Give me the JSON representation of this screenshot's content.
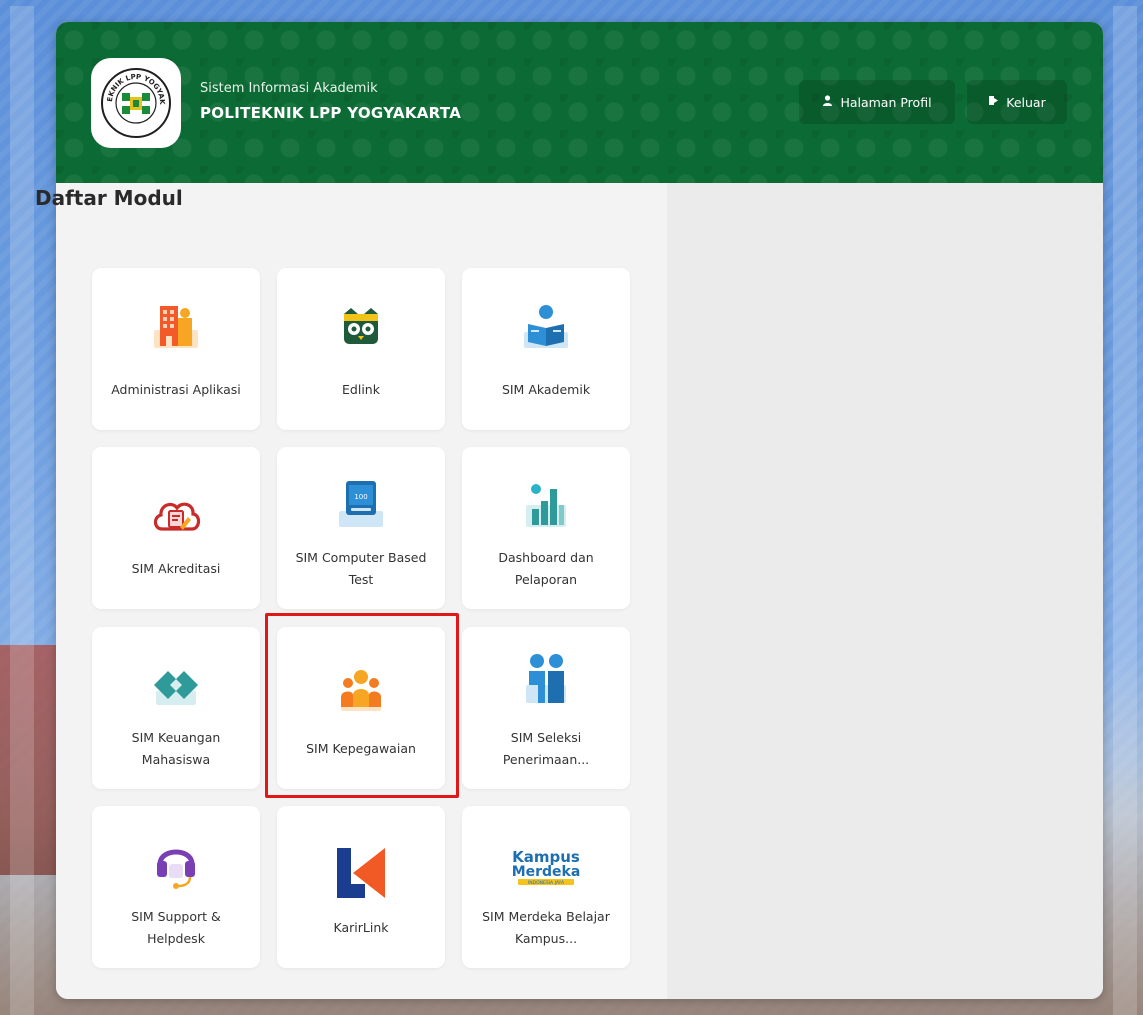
{
  "header": {
    "subtitle": "Sistem Informasi Akademik",
    "title": "POLITEKNIK LPP YOGYAKARTA",
    "logo_ring_text": "POLITEKNIK LPP YOGYAKARTA",
    "buttons": {
      "profile_label": "Halaman Profil",
      "profile_icon": "user-icon",
      "logout_label": "Keluar",
      "logout_icon": "logout-icon"
    }
  },
  "section": {
    "title": "Daftar Modul"
  },
  "modules": [
    {
      "label": "Administrasi Aplikasi",
      "icon": "building-icon"
    },
    {
      "label": "Edlink",
      "icon": "owl-icon"
    },
    {
      "label": "SIM Akademik",
      "icon": "reader-icon"
    },
    {
      "label": "SIM Akreditasi",
      "icon": "cloud-document-icon"
    },
    {
      "label": "SIM Computer Based Test",
      "icon": "computer-test-icon",
      "icon_text": "100"
    },
    {
      "label": "Dashboard dan Pelaporan",
      "icon": "bar-chart-icon"
    },
    {
      "label": "SIM Keuangan Mahasiswa",
      "icon": "diamond-icon"
    },
    {
      "label": "SIM Kepegawaian",
      "icon": "employees-icon"
    },
    {
      "label": "SIM Seleksi Penerimaan...",
      "icon": "selection-people-icon"
    },
    {
      "label": "SIM Support & Helpdesk",
      "icon": "headset-icon"
    },
    {
      "label": "KarirLink",
      "icon": "karirlink-logo-icon"
    },
    {
      "label": "SIM Merdeka Belajar Kampus...",
      "icon": "kampus-merdeka-logo-icon",
      "icon_text": [
        "Kampus",
        "Merdeka",
        "INDONESIA JAYA"
      ]
    }
  ],
  "colors": {
    "header_green": "#0c6b34",
    "highlight_red": "#e01818",
    "building_orange": "#f47b20",
    "blue_accent": "#2d8fd5",
    "teal_accent": "#2e9a9a",
    "purple_accent": "#7b3fb5"
  }
}
